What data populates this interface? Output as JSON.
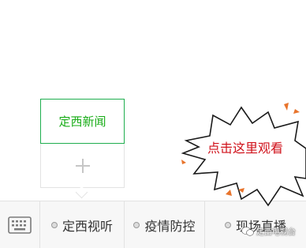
{
  "submenu": {
    "items": [
      {
        "label": "定西新闻"
      }
    ],
    "add_icon": "plus-icon"
  },
  "bottom_bar": {
    "keyboard_icon": "keyboard-icon",
    "tabs": [
      {
        "label": "定西视听",
        "icon": "dot-icon"
      },
      {
        "label": "疫情防控",
        "icon": "dot-icon"
      },
      {
        "label": "现场直播",
        "icon": "dot-icon"
      }
    ]
  },
  "callout": {
    "text": "点击这里观看",
    "text_color": "#d0121b",
    "accent_color": "#e8742c"
  },
  "watermark": {
    "text": "定西电视台"
  },
  "colors": {
    "menu_green": "#1aad19",
    "bar_bg": "#f7f7f7"
  }
}
